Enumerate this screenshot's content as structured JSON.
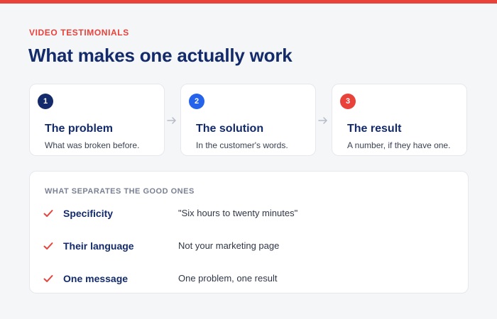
{
  "header": {
    "eyebrow": "VIDEO TESTIMONIALS",
    "title": "What makes one actually work"
  },
  "steps": [
    {
      "number": "1",
      "title": "The problem",
      "description": "What was broken before.",
      "color": "#132a6b"
    },
    {
      "number": "2",
      "title": "The solution",
      "description": "In the customer's words.",
      "color": "#2563eb"
    },
    {
      "number": "3",
      "title": "The result",
      "description": "A number, if they have one.",
      "color": "#e8423b"
    }
  ],
  "separators": {
    "heading": "WHAT SEPARATES THE GOOD ONES",
    "items": [
      {
        "label": "Specificity",
        "value": "\"Six hours to twenty minutes\""
      },
      {
        "label": "Their language",
        "value": "Not your marketing page"
      },
      {
        "label": "One message",
        "value": "One problem, one result"
      }
    ]
  },
  "colors": {
    "accent": "#e8423b",
    "navy": "#132a6b",
    "blue": "#2563eb",
    "background": "#f5f6f8",
    "arrow": "#b6bcc8"
  },
  "icons": {
    "arrow": "arrow-right-icon",
    "check": "check-icon"
  }
}
